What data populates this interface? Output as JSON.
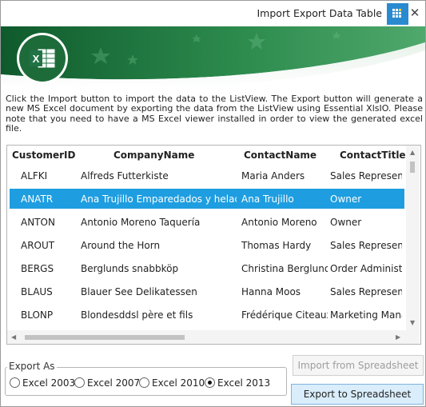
{
  "window": {
    "title": "Import Export Data Table",
    "close_glyph": "✕"
  },
  "banner": {
    "logo_letter": "X"
  },
  "description": "Click the Import button to import the data to the ListView. The Export button will generate a new MS Excel document by exporting the data from the ListView using Essential XlsIO. Please note that you need to have a MS Excel viewer installed in order to view the generated excel file.",
  "listview": {
    "columns": [
      "CustomerID",
      "CompanyName",
      "ContactName",
      "ContactTitle"
    ],
    "rows": [
      [
        "ALFKI",
        "Alfreds Futterkiste",
        "Maria Anders",
        "Sales Representat"
      ],
      [
        "ANATR",
        "Ana Trujillo Emparedados y helados",
        "Ana Trujillo",
        "Owner"
      ],
      [
        "ANTON",
        "Antonio Moreno Taquería",
        "Antonio Moreno",
        "Owner"
      ],
      [
        "AROUT",
        "Around the Horn",
        "Thomas Hardy",
        "Sales Representat"
      ],
      [
        "BERGS",
        "Berglunds snabbköp",
        "Christina Berglund",
        "Order Administrat"
      ],
      [
        "BLAUS",
        "Blauer See Delikatessen",
        "Hanna Moos",
        "Sales Representat"
      ],
      [
        "BLONP",
        "Blondesddsl père et fils",
        "Frédérique Citeaux",
        "Marketing Manag"
      ]
    ],
    "selected_index": 1
  },
  "export_as": {
    "legend": "Export As",
    "options": [
      "Excel 2003",
      "Excel 2007",
      "Excel 2010",
      "Excel 2013"
    ],
    "selected": "Excel 2013"
  },
  "buttons": {
    "import_label": "Import from Spreadsheet",
    "export_label": "Export to Spreadsheet"
  },
  "colors": {
    "accent": "#1e9ee0",
    "banner_green": "#1e6b3a",
    "excel_green": "#217346"
  },
  "icons": [
    "app-grid-icon",
    "close-icon",
    "excel-logo-icon",
    "scroll-up-icon",
    "scroll-down-icon",
    "scroll-left-icon",
    "scroll-right-icon"
  ]
}
